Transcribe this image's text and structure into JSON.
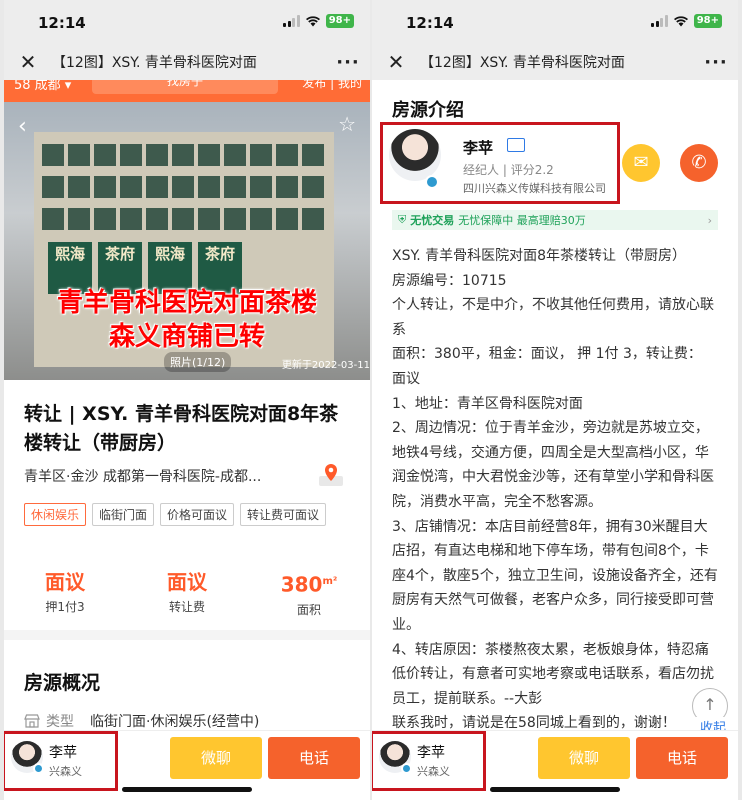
{
  "status": {
    "time": "12:14",
    "battery": "98+"
  },
  "nav": {
    "close_icon": "close-icon",
    "title": "【12图】XSY. 青羊骨科医院对面",
    "more": "···"
  },
  "left": {
    "strip": {
      "city": "58 成都 ▾",
      "search": "找房子",
      "right": "发布 | 我的"
    },
    "photo": {
      "overlay_line1": "青羊骨科医院对面茶楼",
      "overlay_line2": "森义商铺已转",
      "counter": "照片(1/12)",
      "date": "更新于2022-03-11",
      "signs": [
        "熙海",
        "茶府",
        "熙海",
        "茶府"
      ]
    },
    "listing_title": "转让 | XSY. 青羊骨科医院对面8年茶楼转让（带厨房）",
    "address": "青羊区·金沙 成都第一骨科医院-成都...",
    "tags": [
      {
        "label": "休闲娱乐",
        "highlight": true
      },
      {
        "label": "临街门面",
        "highlight": false
      },
      {
        "label": "价格可面议",
        "highlight": false
      },
      {
        "label": "转让费可面议",
        "highlight": false
      }
    ],
    "stats": [
      {
        "value": "面议",
        "label": "押1付3"
      },
      {
        "value": "面议",
        "label": "转让费"
      },
      {
        "value": "380",
        "unit": "m²",
        "label": "面积"
      }
    ],
    "overview_title": "房源概况",
    "type_label": "类型",
    "type_value": "临街门面·休闲娱乐(经营中)"
  },
  "right": {
    "section_title": "房源介绍",
    "agent": {
      "name": "李苹",
      "role": "经纪人",
      "rating": "评分2.2",
      "company": "四川兴森义传媒科技有限公司"
    },
    "guarantee": {
      "brand": "无忧交易",
      "text": "无忧保障中 最高理赔30万"
    },
    "description": [
      "XSY. 青羊骨科医院对面8年茶楼转让（带厨房）",
      "房源编号：10715",
      "个人转让，不是中介，不收其他任何费用，请放心联系",
      "面积：380平，租金：面议， 押 1付 3，转让费： 面议",
      "1、地址：青羊区骨科医院对面",
      "2、周边情况：位于青羊金沙，旁边就是苏坡立交，地铁4号线，交通方便，四周全是大型高档小区，华润金悦湾，中大君悦金沙等，还有草堂小学和骨科医院，消费水平高，完全不愁客源。",
      "3、店铺情况：本店目前经营8年，拥有30米醒目大店招，有直达电梯和地下停车场，带有包间8个，卡座4个，散座5个，独立卫生间，设施设备齐全，还有厨房有天然气可做餐，老客户众多，同行接受即可营业。",
      "4、转店原因：茶楼熬夜太累，老板娘身体，特忍痛低价转让，有意者可实地考察或电话联系，看店勿扰员工，提前联系。--大彭",
      "联系我时，请说是在58同城上看到的，谢谢！"
    ],
    "collapse": "收起"
  },
  "bottom": {
    "name": "李苹",
    "company": "兴森义",
    "chat": "微聊",
    "call": "电话"
  }
}
